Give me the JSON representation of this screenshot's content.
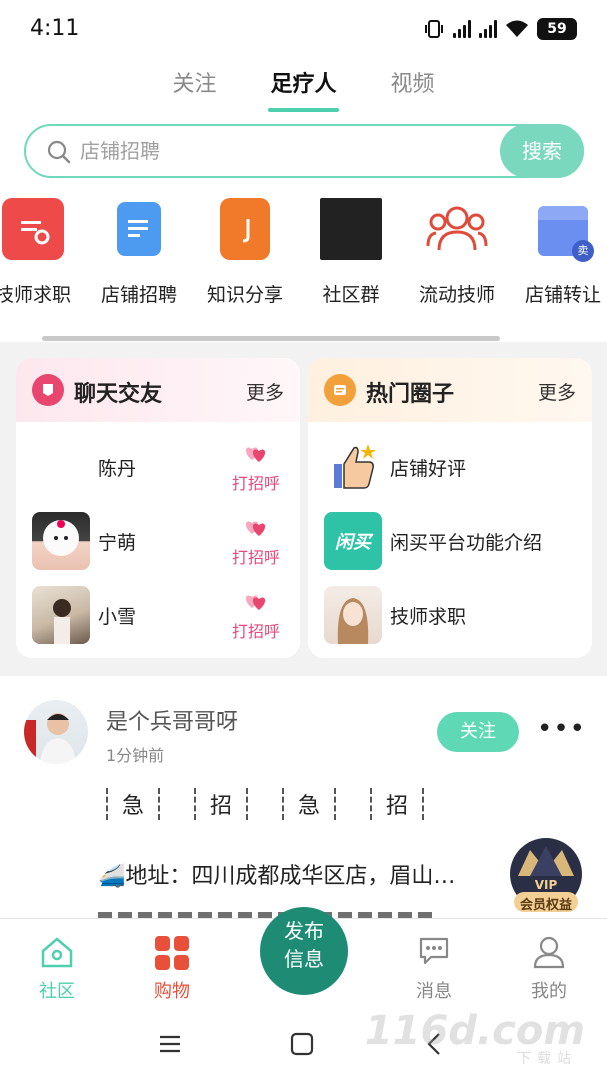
{
  "status_bar": {
    "time": "4:11",
    "battery": "59"
  },
  "top_tabs": [
    {
      "label": "关注"
    },
    {
      "label": "足疗人",
      "active": true
    },
    {
      "label": "视频"
    }
  ],
  "search": {
    "placeholder": "店铺招聘",
    "button": "搜索"
  },
  "categories": [
    {
      "label": "技师求职",
      "icon": "resume-search-icon"
    },
    {
      "label": "店铺招聘",
      "icon": "document-icon"
    },
    {
      "label": "知识分享",
      "icon": "book-icon"
    },
    {
      "label": "社区群",
      "icon": "group-photo-icon"
    },
    {
      "label": "流动技师",
      "icon": "people-icon"
    },
    {
      "label": "店铺转让",
      "icon": "shop-transfer-icon"
    }
  ],
  "chat_card": {
    "title": "聊天交友",
    "more": "更多",
    "rows": [
      {
        "name": "陈丹",
        "action": "打招呼"
      },
      {
        "name": "宁萌",
        "action": "打招呼"
      },
      {
        "name": "小雪",
        "action": "打招呼"
      }
    ]
  },
  "circle_card": {
    "title": "热门圈子",
    "more": "更多",
    "rows": [
      {
        "name": "店铺好评"
      },
      {
        "name": "闲买平台功能介绍",
        "logo_text": "闲买"
      },
      {
        "name": "技师求职"
      }
    ]
  },
  "post": {
    "user": "是个兵哥哥呀",
    "time": "1分钟前",
    "follow": "关注",
    "tags": [
      "急",
      "招",
      "急",
      "招"
    ],
    "address": "🚄地址：四川成都成华区店，眉山…"
  },
  "vip": {
    "badge": "VIP",
    "label": "会员权益"
  },
  "bottom_nav": {
    "community": "社区",
    "shopping": "购物",
    "publish_line1": "发布",
    "publish_line2": "信息",
    "messages": "消息",
    "mine": "我的"
  },
  "colors": {
    "accent": "#4ecfae",
    "publish": "#1e8c74",
    "greet": "#e54a7b",
    "shopping": "#e8503a"
  },
  "watermark": {
    "main": "116d.com",
    "sub": "下载站"
  }
}
